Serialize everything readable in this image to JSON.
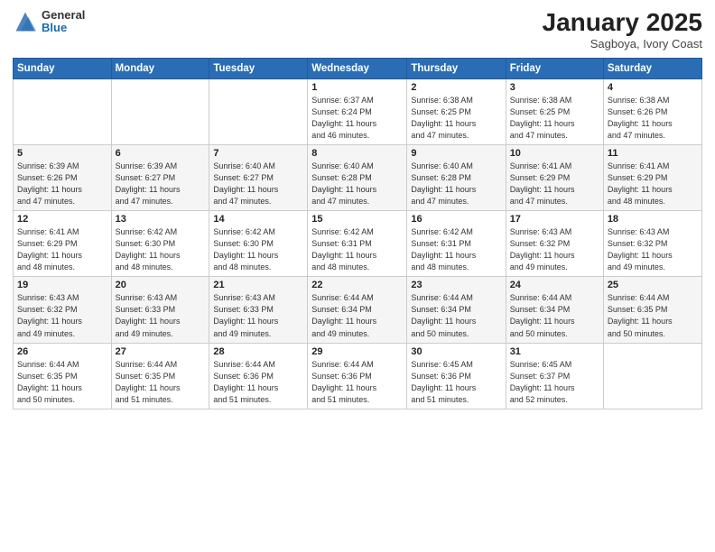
{
  "header": {
    "logo_general": "General",
    "logo_blue": "Blue",
    "month_title": "January 2025",
    "subtitle": "Sagboya, Ivory Coast"
  },
  "days_of_week": [
    "Sunday",
    "Monday",
    "Tuesday",
    "Wednesday",
    "Thursday",
    "Friday",
    "Saturday"
  ],
  "weeks": [
    [
      {
        "day": "",
        "info": ""
      },
      {
        "day": "",
        "info": ""
      },
      {
        "day": "",
        "info": ""
      },
      {
        "day": "1",
        "info": "Sunrise: 6:37 AM\nSunset: 6:24 PM\nDaylight: 11 hours\nand 46 minutes."
      },
      {
        "day": "2",
        "info": "Sunrise: 6:38 AM\nSunset: 6:25 PM\nDaylight: 11 hours\nand 47 minutes."
      },
      {
        "day": "3",
        "info": "Sunrise: 6:38 AM\nSunset: 6:25 PM\nDaylight: 11 hours\nand 47 minutes."
      },
      {
        "day": "4",
        "info": "Sunrise: 6:38 AM\nSunset: 6:26 PM\nDaylight: 11 hours\nand 47 minutes."
      }
    ],
    [
      {
        "day": "5",
        "info": "Sunrise: 6:39 AM\nSunset: 6:26 PM\nDaylight: 11 hours\nand 47 minutes."
      },
      {
        "day": "6",
        "info": "Sunrise: 6:39 AM\nSunset: 6:27 PM\nDaylight: 11 hours\nand 47 minutes."
      },
      {
        "day": "7",
        "info": "Sunrise: 6:40 AM\nSunset: 6:27 PM\nDaylight: 11 hours\nand 47 minutes."
      },
      {
        "day": "8",
        "info": "Sunrise: 6:40 AM\nSunset: 6:28 PM\nDaylight: 11 hours\nand 47 minutes."
      },
      {
        "day": "9",
        "info": "Sunrise: 6:40 AM\nSunset: 6:28 PM\nDaylight: 11 hours\nand 47 minutes."
      },
      {
        "day": "10",
        "info": "Sunrise: 6:41 AM\nSunset: 6:29 PM\nDaylight: 11 hours\nand 47 minutes."
      },
      {
        "day": "11",
        "info": "Sunrise: 6:41 AM\nSunset: 6:29 PM\nDaylight: 11 hours\nand 48 minutes."
      }
    ],
    [
      {
        "day": "12",
        "info": "Sunrise: 6:41 AM\nSunset: 6:29 PM\nDaylight: 11 hours\nand 48 minutes."
      },
      {
        "day": "13",
        "info": "Sunrise: 6:42 AM\nSunset: 6:30 PM\nDaylight: 11 hours\nand 48 minutes."
      },
      {
        "day": "14",
        "info": "Sunrise: 6:42 AM\nSunset: 6:30 PM\nDaylight: 11 hours\nand 48 minutes."
      },
      {
        "day": "15",
        "info": "Sunrise: 6:42 AM\nSunset: 6:31 PM\nDaylight: 11 hours\nand 48 minutes."
      },
      {
        "day": "16",
        "info": "Sunrise: 6:42 AM\nSunset: 6:31 PM\nDaylight: 11 hours\nand 48 minutes."
      },
      {
        "day": "17",
        "info": "Sunrise: 6:43 AM\nSunset: 6:32 PM\nDaylight: 11 hours\nand 49 minutes."
      },
      {
        "day": "18",
        "info": "Sunrise: 6:43 AM\nSunset: 6:32 PM\nDaylight: 11 hours\nand 49 minutes."
      }
    ],
    [
      {
        "day": "19",
        "info": "Sunrise: 6:43 AM\nSunset: 6:32 PM\nDaylight: 11 hours\nand 49 minutes."
      },
      {
        "day": "20",
        "info": "Sunrise: 6:43 AM\nSunset: 6:33 PM\nDaylight: 11 hours\nand 49 minutes."
      },
      {
        "day": "21",
        "info": "Sunrise: 6:43 AM\nSunset: 6:33 PM\nDaylight: 11 hours\nand 49 minutes."
      },
      {
        "day": "22",
        "info": "Sunrise: 6:44 AM\nSunset: 6:34 PM\nDaylight: 11 hours\nand 49 minutes."
      },
      {
        "day": "23",
        "info": "Sunrise: 6:44 AM\nSunset: 6:34 PM\nDaylight: 11 hours\nand 50 minutes."
      },
      {
        "day": "24",
        "info": "Sunrise: 6:44 AM\nSunset: 6:34 PM\nDaylight: 11 hours\nand 50 minutes."
      },
      {
        "day": "25",
        "info": "Sunrise: 6:44 AM\nSunset: 6:35 PM\nDaylight: 11 hours\nand 50 minutes."
      }
    ],
    [
      {
        "day": "26",
        "info": "Sunrise: 6:44 AM\nSunset: 6:35 PM\nDaylight: 11 hours\nand 50 minutes."
      },
      {
        "day": "27",
        "info": "Sunrise: 6:44 AM\nSunset: 6:35 PM\nDaylight: 11 hours\nand 51 minutes."
      },
      {
        "day": "28",
        "info": "Sunrise: 6:44 AM\nSunset: 6:36 PM\nDaylight: 11 hours\nand 51 minutes."
      },
      {
        "day": "29",
        "info": "Sunrise: 6:44 AM\nSunset: 6:36 PM\nDaylight: 11 hours\nand 51 minutes."
      },
      {
        "day": "30",
        "info": "Sunrise: 6:45 AM\nSunset: 6:36 PM\nDaylight: 11 hours\nand 51 minutes."
      },
      {
        "day": "31",
        "info": "Sunrise: 6:45 AM\nSunset: 6:37 PM\nDaylight: 11 hours\nand 52 minutes."
      },
      {
        "day": "",
        "info": ""
      }
    ]
  ]
}
